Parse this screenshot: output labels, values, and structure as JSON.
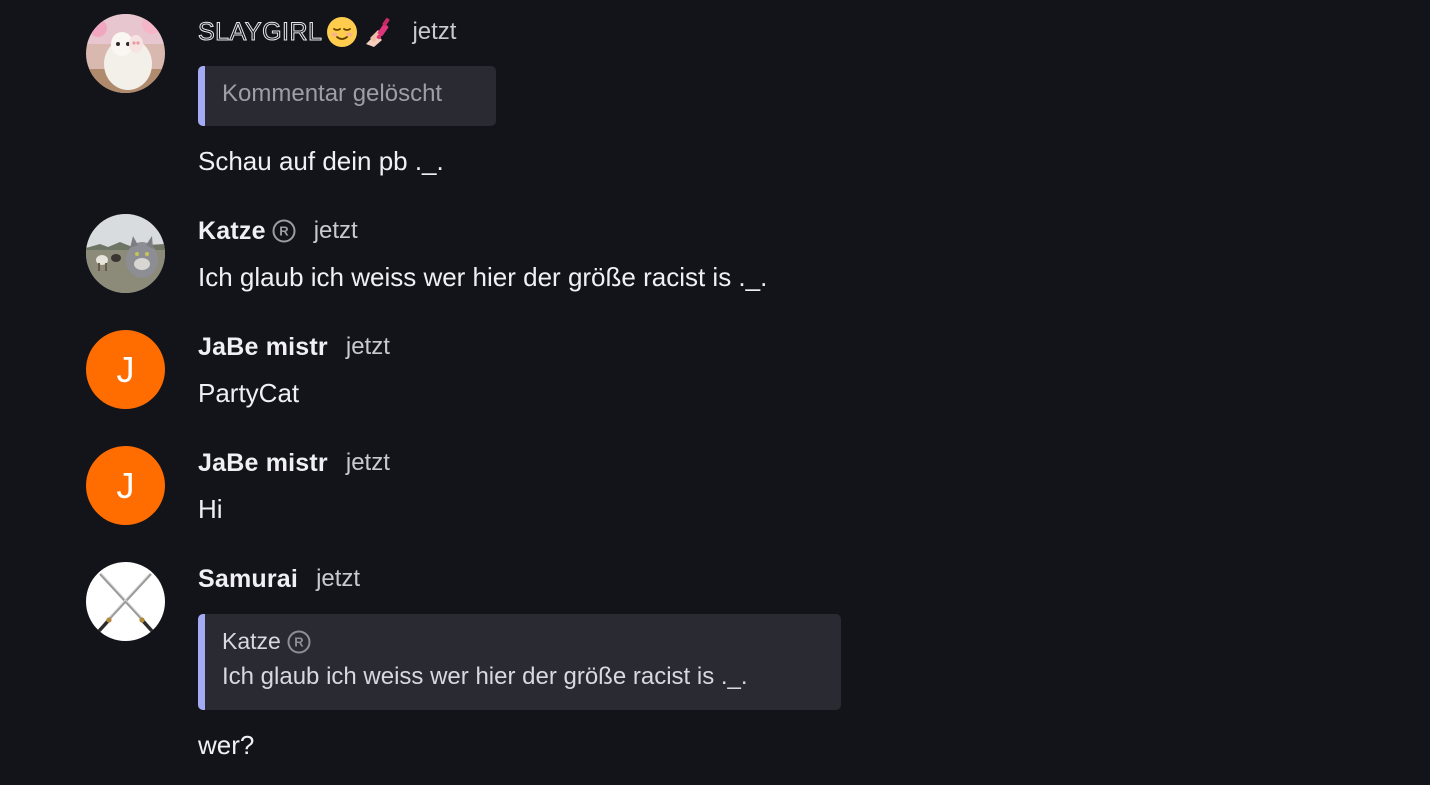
{
  "messages": [
    {
      "author": "SLAYGIRL",
      "emojis": [
        "relieved-face-emoji",
        "nail-polish-emoji"
      ],
      "time": "jetzt",
      "quote": {
        "deleted_text": "Kommentar gelöscht"
      },
      "text": "Schau auf dein pb ._."
    },
    {
      "author": "Katze",
      "badge": "registered-icon",
      "time": "jetzt",
      "text": "Ich glaub ich weiss wer hier der größe racist is ._."
    },
    {
      "author": "JaBe mistr",
      "avatar_letter": "J",
      "time": "jetzt",
      "text": "PartyCat"
    },
    {
      "author": "JaBe mistr",
      "avatar_letter": "J",
      "time": "jetzt",
      "text": "Hi"
    },
    {
      "author": "Samurai",
      "time": "jetzt",
      "quote": {
        "author": "Katze",
        "author_badge": "registered-icon",
        "text": "Ich glaub ich weiss wer hier der größe racist is ._."
      },
      "text": "wer?"
    }
  ],
  "colors": {
    "background": "#13141a",
    "quote_background": "#2a2b32",
    "quote_accent": "#a5aaf5",
    "letter_avatar": "#ff6d00"
  }
}
